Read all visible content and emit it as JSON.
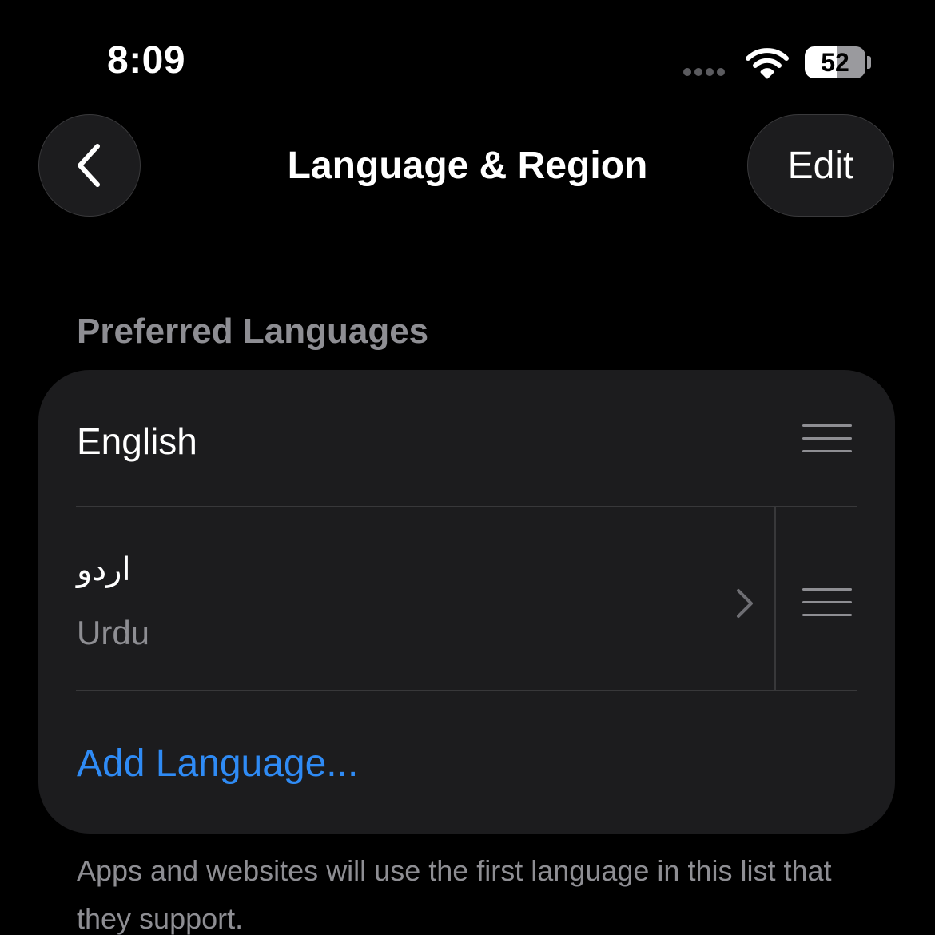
{
  "status_bar": {
    "time": "8:09",
    "battery_level": "52",
    "battery_fraction": 0.52,
    "wifi_icon": "wifi-icon"
  },
  "nav": {
    "back_icon": "chevron-left-icon",
    "title": "Language & Region",
    "edit_label": "Edit"
  },
  "preferred_languages": {
    "header": "Preferred Languages",
    "items": [
      {
        "name": "English"
      },
      {
        "native_name": "اردو",
        "name": "Urdu",
        "chevron_icon": "chevron-right-icon"
      }
    ],
    "add_label": "Add Language...",
    "footer": "Apps and websites will use the first language in this list that they support."
  },
  "colors": {
    "background": "#000000",
    "card": "#1c1c1e",
    "accent": "#2f8bf5",
    "secondary_text": "#8e8e93"
  }
}
